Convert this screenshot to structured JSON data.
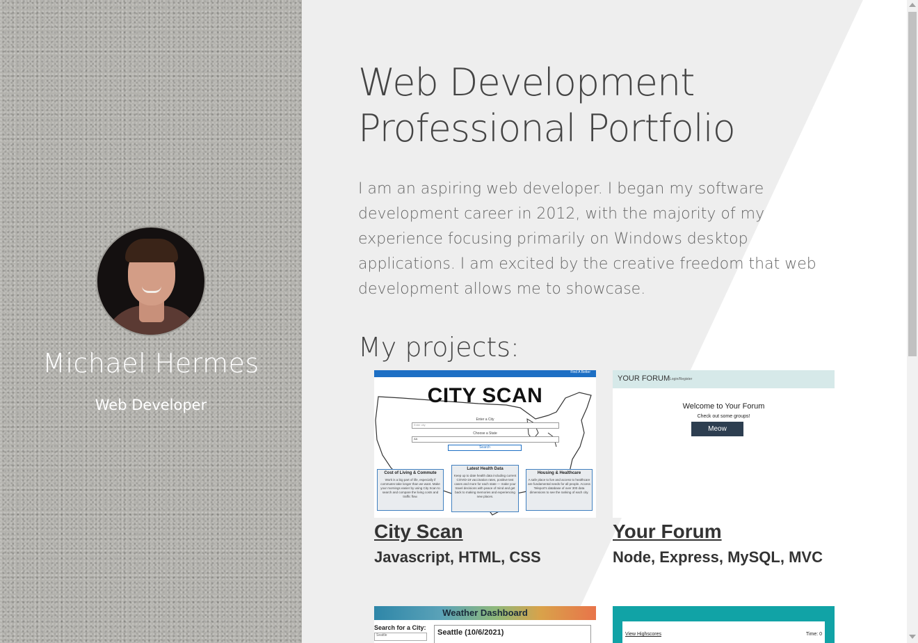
{
  "sidebar": {
    "name": "Michael Hermes",
    "role": "Web Developer",
    "avatar_alt": "profile photo"
  },
  "header": {
    "title_line1": "Web Development",
    "title_line2": "Professional Portfolio"
  },
  "about": {
    "text": "I am an aspiring web developer. I began my software development career in 2012, with the majority of my experience focusing primarily on Windows desktop applications. I am excited by the creative freedom that web development allows me to showcase."
  },
  "projects": {
    "heading": "My projects:",
    "items": [
      {
        "title": "City Scan",
        "tech": "Javascript, HTML, CSS",
        "thumb": {
          "banner": "CITY SCAN",
          "nav_link": "Find A Better",
          "enter_label": "Enter a City",
          "enter_placeholder": "Enter city",
          "state_label": "Choose a State",
          "state_value": "AA",
          "search_button": "Search",
          "boxes": [
            {
              "heading": "Cost of Living & Commute",
              "text": "Work is a big part of life, especially if commutes take longer than we want. Make your mornings easier by using City Scan to search and compare the living costs and traffic flow."
            },
            {
              "heading": "Latest Health Data",
              "text": "Keep up to date health data including current COVID-19 vaccination rates, positive test cases and more for each state — make your travel decisions with peace of mind and get back to making memories and experiencing new places."
            },
            {
              "heading": "Housing & Healthcare",
              "text": "A safe place to live and access to healthcare are fundamental needs for all people. Access Teleport's database of over 300 data dimensions to see the ranking of each city."
            }
          ]
        }
      },
      {
        "title": "Your Forum",
        "tech": "Node, Express, MySQL, MVC",
        "thumb": {
          "brand": "YOUR FORUM",
          "login": "Login/Register",
          "welcome": "Welcome to Your Forum",
          "subtitle": "Check out some groups!",
          "button": "Meow"
        }
      },
      {
        "title": "",
        "tech": "",
        "thumb": {
          "banner": "Weather Dashboard",
          "search_label": "Search for a City:",
          "search_value": "Seattle",
          "card_title": "Seattle (10/6/2021)"
        }
      },
      {
        "title": "",
        "tech": "",
        "thumb": {
          "highscores": "View Highscores",
          "time": "Time: 0"
        }
      }
    ]
  },
  "colors": {
    "sidebar_bg": "#b3b2ad",
    "main_panel": "#eeeeee",
    "heading_text": "#444444",
    "body_text": "#666666"
  }
}
